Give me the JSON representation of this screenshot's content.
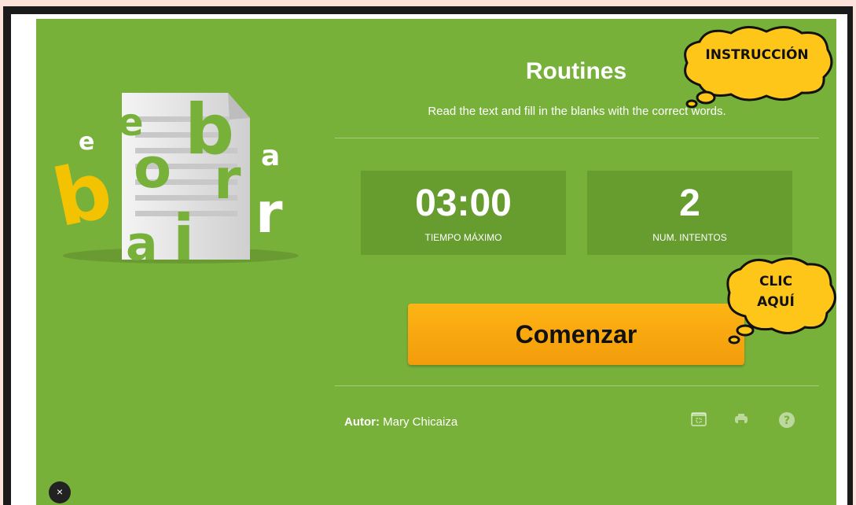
{
  "activity": {
    "title": "Routines",
    "subtitle": "Read the text and fill in the blanks with the correct words."
  },
  "stats": [
    {
      "value": "03:00",
      "label": "TIEMPO MÁXIMO"
    },
    {
      "value": "2",
      "label": "NUM. INTENTOS"
    }
  ],
  "start_button": {
    "label": "Comenzar"
  },
  "footer": {
    "author_label": "Autor:",
    "author_name": "Mary Chicaiza",
    "icons": [
      "fullscreen-icon",
      "print-icon",
      "help-icon"
    ]
  },
  "callouts": {
    "instruction": "INSTRUCCIÓN",
    "click_line1": "CLIC",
    "click_line2": "AQUÍ"
  },
  "close_button": {
    "label": "×"
  },
  "colors": {
    "panel_green": "#78b13a",
    "stat_green": "#679c2f",
    "button_orange": "#f5a40f",
    "bubble_yellow": "#ffc61a"
  }
}
